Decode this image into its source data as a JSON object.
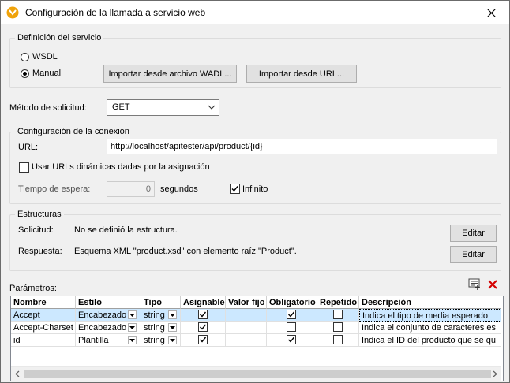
{
  "window": {
    "title": "Configuración de la llamada a servicio web"
  },
  "service_definition": {
    "group_title": "Definición del servicio",
    "wsdl_label": "WSDL",
    "manual_label": "Manual",
    "selected": "manual",
    "import_wadl_button": "Importar desde archivo WADL...",
    "import_url_button": "Importar desde URL..."
  },
  "request_method": {
    "label": "Método de solicitud:",
    "value": "GET"
  },
  "connection": {
    "group_title": "Configuración de la conexión",
    "url_label": "URL:",
    "url_value": "http://localhost/apitester/api/product/{id}",
    "dynamic_urls_label": "Usar URLs dinámicas dadas por la asignación",
    "dynamic_urls_checked": false,
    "timeout_label": "Tiempo de espera:",
    "timeout_value": "0",
    "timeout_unit": "segundos",
    "infinite_label": "Infinito",
    "infinite_checked": true
  },
  "structures": {
    "group_title": "Estructuras",
    "request_label": "Solicitud:",
    "request_value": "No se definió la estructura.",
    "response_label": "Respuesta:",
    "response_value": "Esquema XML \"product.xsd\" con elemento raíz \"Product\".",
    "edit_button": "Editar"
  },
  "parameters": {
    "label": "Parámetros:",
    "columns": [
      "Nombre",
      "Estilo",
      "Tipo",
      "Asignable",
      "Valor fijo",
      "Obligatorio",
      "Repetido",
      "Descripción"
    ],
    "rows": [
      {
        "name": "Accept",
        "style": "Encabezado",
        "type": "string",
        "assignable": true,
        "fixed": "",
        "required": true,
        "repeated": false,
        "description": "Indica el tipo de media esperado",
        "selected": true
      },
      {
        "name": "Accept-Charset",
        "style": "Encabezado",
        "type": "string",
        "assignable": true,
        "fixed": "",
        "required": false,
        "repeated": false,
        "description": "Indica el conjunto de caracteres es",
        "selected": false
      },
      {
        "name": "id",
        "style": "Plantilla",
        "type": "string",
        "assignable": true,
        "fixed": "",
        "required": true,
        "repeated": false,
        "description": "Indica el ID del producto que se qu",
        "selected": false
      }
    ]
  },
  "colors": {
    "selection": "#cce8ff",
    "delete_icon": "#d40000",
    "app_icon": "#f0a30a"
  }
}
